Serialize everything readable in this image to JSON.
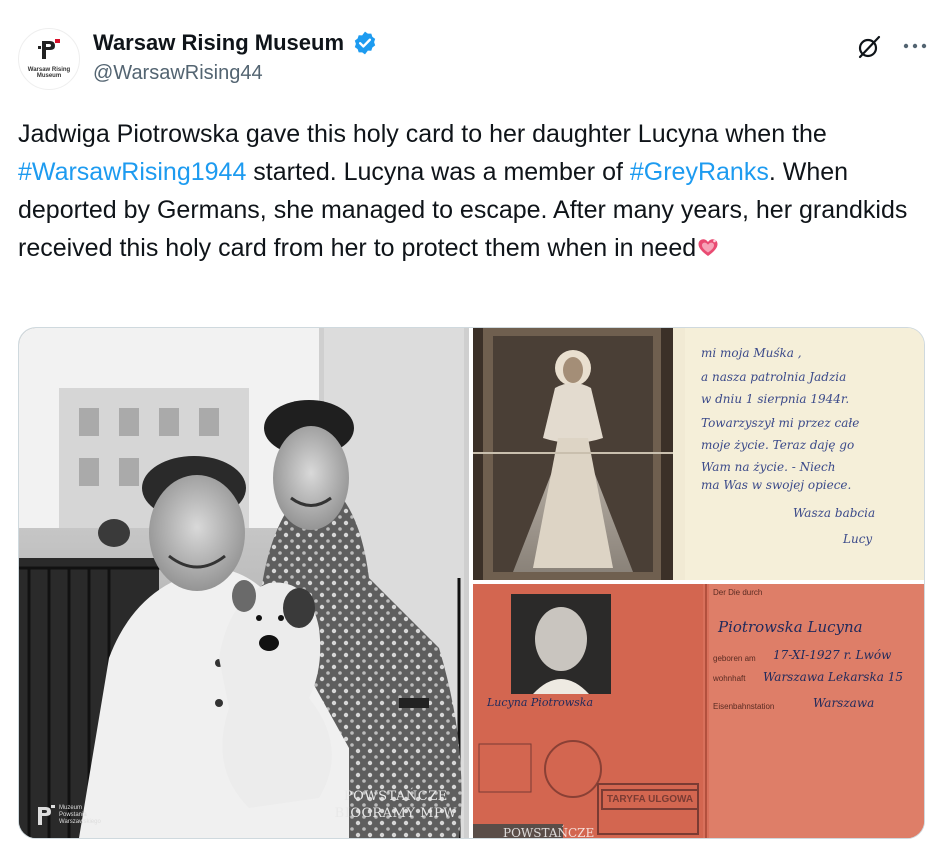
{
  "account": {
    "display_name": "Warsaw Rising Museum",
    "handle": "@WarsawRising44",
    "avatar_text": "Warsaw Rising Museum",
    "verified_color": "#1d9bf0"
  },
  "icons": {
    "grok": "grok-icon",
    "more": "more-icon",
    "verified": "verified-badge-icon",
    "emoji": "sparkling-heart-icon"
  },
  "tweet": {
    "text_1": "Jadwiga Piotrowska gave this holy card to her daughter Lucyna when the ",
    "hashtag_1": "#WarsawRising1944",
    "text_2": " started. Lucyna was a member of ",
    "hashtag_2": "#GreyRanks",
    "text_3": ". When deported by Germans, she managed to escape. After many years, her grandkids received this holy card from her to protect them when in need",
    "hashtag_color": "#1d9bf0"
  },
  "media": {
    "watermark_line1": "POWSTAŃCZE",
    "watermark_line2": "BIOGRAMY MPW",
    "watermark_small": "POWSTAŃCZE",
    "logo_small_text": "Muzeum Powstania Warszawskiego",
    "card_note": [
      "mi moja Muśka ,",
      "a nasza patrolnia Jadzia",
      "w dniu 1 sierpnia 1944r.",
      "Towarzyszył mi przez całe",
      "moje życie. Teraz daję go",
      "Wam na życie. - Niech",
      "ma Was w swojej opiece.",
      "Wasza babcia",
      "Lucy"
    ],
    "id_card": {
      "name": "Piotrowska Lucyna",
      "birth": "17-XI-1927 r. Lwów",
      "address": "Warszawa Lekarska 15",
      "station": "Warszawa",
      "signature": "Lucyna Piotrowska",
      "stamp": "TARYFA ULGOWA"
    }
  }
}
